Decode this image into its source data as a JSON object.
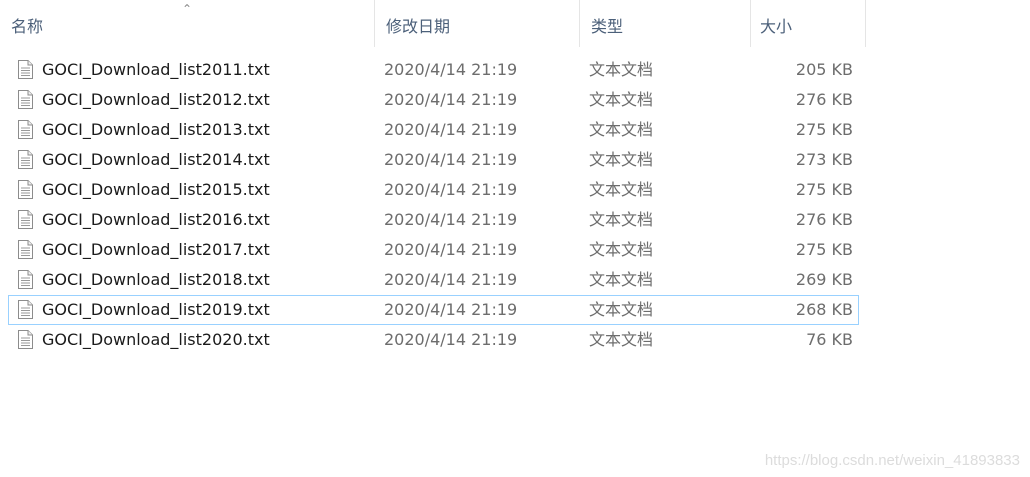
{
  "header": {
    "columns": {
      "name": "名称",
      "date": "修改日期",
      "type": "类型",
      "size": "大小"
    }
  },
  "files": [
    {
      "name": "GOCI_Download_list2011.txt",
      "date": "2020/4/14 21:19",
      "type": "文本文档",
      "size": "205 KB"
    },
    {
      "name": "GOCI_Download_list2012.txt",
      "date": "2020/4/14 21:19",
      "type": "文本文档",
      "size": "276 KB"
    },
    {
      "name": "GOCI_Download_list2013.txt",
      "date": "2020/4/14 21:19",
      "type": "文本文档",
      "size": "275 KB"
    },
    {
      "name": "GOCI_Download_list2014.txt",
      "date": "2020/4/14 21:19",
      "type": "文本文档",
      "size": "273 KB"
    },
    {
      "name": "GOCI_Download_list2015.txt",
      "date": "2020/4/14 21:19",
      "type": "文本文档",
      "size": "275 KB"
    },
    {
      "name": "GOCI_Download_list2016.txt",
      "date": "2020/4/14 21:19",
      "type": "文本文档",
      "size": "276 KB"
    },
    {
      "name": "GOCI_Download_list2017.txt",
      "date": "2020/4/14 21:19",
      "type": "文本文档",
      "size": "275 KB"
    },
    {
      "name": "GOCI_Download_list2018.txt",
      "date": "2020/4/14 21:19",
      "type": "文本文档",
      "size": "269 KB"
    },
    {
      "name": "GOCI_Download_list2019.txt",
      "date": "2020/4/14 21:19",
      "type": "文本文档",
      "size": "268 KB"
    },
    {
      "name": "GOCI_Download_list2020.txt",
      "date": "2020/4/14 21:19",
      "type": "文本文档",
      "size": "76 KB"
    }
  ],
  "watermark": "https://blog.csdn.net/weixin_41893833"
}
